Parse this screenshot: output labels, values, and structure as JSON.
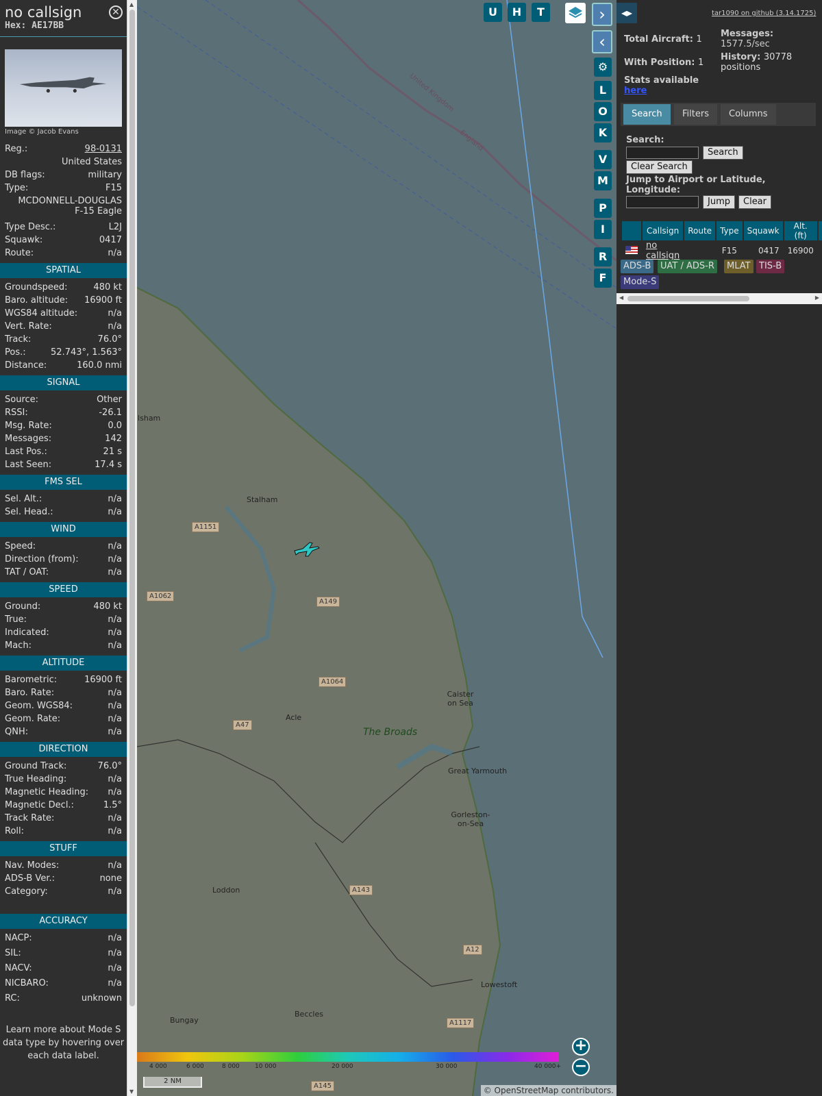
{
  "sidebar": {
    "callsign": "no callsign",
    "hex": "Hex: AE17BB",
    "photo_credit": "Image © Jacob Evans",
    "reg_label": "Reg.:",
    "reg_value": "98-0131",
    "country": "United States",
    "dbflags_label": "DB flags:",
    "dbflags_value": "military",
    "type_label": "Type:",
    "type_value": "F15",
    "type_name": "MCDONNELL-DOUGLAS F-15 Eagle",
    "typedesc_label": "Type Desc.:",
    "typedesc_value": "L2J",
    "squawk_label": "Squawk:",
    "squawk_value": "0417",
    "route_label": "Route:",
    "route_value": "n/a",
    "sections": {
      "spatial": "SPATIAL",
      "signal": "SIGNAL",
      "fms": "FMS SEL",
      "wind": "WIND",
      "speed": "SPEED",
      "altitude": "ALTITUDE",
      "direction": "DIRECTION",
      "stuff": "STUFF",
      "accuracy": "ACCURACY"
    },
    "spatial": [
      [
        "Groundspeed:",
        "480 kt"
      ],
      [
        "Baro. altitude:",
        "16900 ft"
      ],
      [
        "WGS84 altitude:",
        "n/a"
      ],
      [
        "Vert. Rate:",
        "n/a"
      ],
      [
        "Track:",
        "76.0°"
      ],
      [
        "Pos.:",
        "52.743°, 1.563°"
      ],
      [
        "Distance:",
        "160.0 nmi"
      ]
    ],
    "signal": [
      [
        "Source:",
        "Other"
      ],
      [
        "RSSI:",
        "-26.1"
      ],
      [
        "Msg. Rate:",
        "0.0"
      ],
      [
        "Messages:",
        "142"
      ],
      [
        "Last Pos.:",
        "21 s"
      ],
      [
        "Last Seen:",
        "17.4 s"
      ]
    ],
    "fms": [
      [
        "Sel. Alt.:",
        "n/a"
      ],
      [
        "Sel. Head.:",
        "n/a"
      ]
    ],
    "wind": [
      [
        "Speed:",
        "n/a"
      ],
      [
        "Direction (from):",
        "n/a"
      ],
      [
        "TAT / OAT:",
        "n/a"
      ]
    ],
    "speed": [
      [
        "Ground:",
        "480 kt"
      ],
      [
        "True:",
        "n/a"
      ],
      [
        "Indicated:",
        "n/a"
      ],
      [
        "Mach:",
        "n/a"
      ]
    ],
    "altitude": [
      [
        "Barometric:",
        "16900 ft"
      ],
      [
        "Baro. Rate:",
        "n/a"
      ],
      [
        "Geom. WGS84:",
        "n/a"
      ],
      [
        "Geom. Rate:",
        "n/a"
      ],
      [
        "QNH:",
        "n/a"
      ]
    ],
    "direction": [
      [
        "Ground Track:",
        "76.0°"
      ],
      [
        "True Heading:",
        "n/a"
      ],
      [
        "Magnetic Heading:",
        "n/a"
      ],
      [
        "Magnetic Decl.:",
        "1.5°"
      ],
      [
        "Track Rate:",
        "n/a"
      ],
      [
        "Roll:",
        "n/a"
      ]
    ],
    "stuff": [
      [
        "Nav. Modes:",
        "n/a"
      ],
      [
        "ADS-B Ver.:",
        "none"
      ],
      [
        "Category:",
        "n/a"
      ]
    ],
    "accuracy": [
      [
        "NACP:",
        "n/a"
      ],
      [
        "SIL:",
        "n/a"
      ],
      [
        "NACV:",
        "n/a"
      ],
      [
        "NICBARO:",
        "n/a"
      ],
      [
        "RC:",
        "unknown"
      ]
    ],
    "learn_more": "Learn more about Mode S data type by hovering over each data label."
  },
  "map": {
    "top_buttons": [
      "U",
      "H",
      "T"
    ],
    "side_buttons": [
      "L",
      "O",
      "K",
      "V",
      "M",
      "P",
      "I",
      "R",
      "F"
    ],
    "places": [
      "ilsham",
      "Stalham",
      "Caister on Sea",
      "Acle",
      "The Broads",
      "Great Yarmouth",
      "Gorleston-on-Sea",
      "Loddon",
      "Beccles",
      "Bungay",
      "Lowestoft"
    ],
    "roads": [
      "A1151",
      "A1062",
      "A149",
      "A1064",
      "A47",
      "A143",
      "A12",
      "A1117",
      "A145"
    ],
    "border_labels": [
      "United Kingdom",
      "England"
    ],
    "scale": "2 NM",
    "altitude_ticks": [
      "4 000",
      "6 000",
      "8 000",
      "10 000",
      "20 000",
      "30 000",
      "40 000+"
    ],
    "attribution": "© OpenStreetMap contributors."
  },
  "panel": {
    "github": "tar1090 on github (3.14.1725)",
    "total_label": "Total Aircraft:",
    "total_value": "1",
    "pos_label": "With Position:",
    "pos_value": "1",
    "stats_label": "Stats available",
    "stats_link": "here",
    "messages_label": "Messages:",
    "messages_value": "1577.5/sec",
    "history_label": "History:",
    "history_value": "30778 positions",
    "tabs": [
      "Search",
      "Filters",
      "Columns"
    ],
    "search_label": "Search:",
    "search_btn": "Search",
    "clear_search_btn": "Clear Search",
    "jump_label": "Jump to Airport or Latitude, Longitude:",
    "jump_btn": "Jump",
    "clear_btn": "Clear",
    "columns": [
      "Callsign",
      "Route",
      "Type",
      "Squawk",
      "Alt. (ft)",
      "S"
    ],
    "row": {
      "callsign": "no callsign",
      "route": "",
      "type": "F15",
      "squawk": "0417",
      "alt": "16900"
    },
    "badges": [
      "ADS-B",
      "UAT / ADS-R",
      "MLAT",
      "TIS-B",
      "Mode-S"
    ]
  },
  "colors": {
    "accent": "#015d76",
    "adsb": "#3b6a88",
    "uat": "#2f6e45",
    "mlat": "#6e5e2a",
    "tisb": "#6e2a44",
    "modes": "#3b3b7a"
  }
}
